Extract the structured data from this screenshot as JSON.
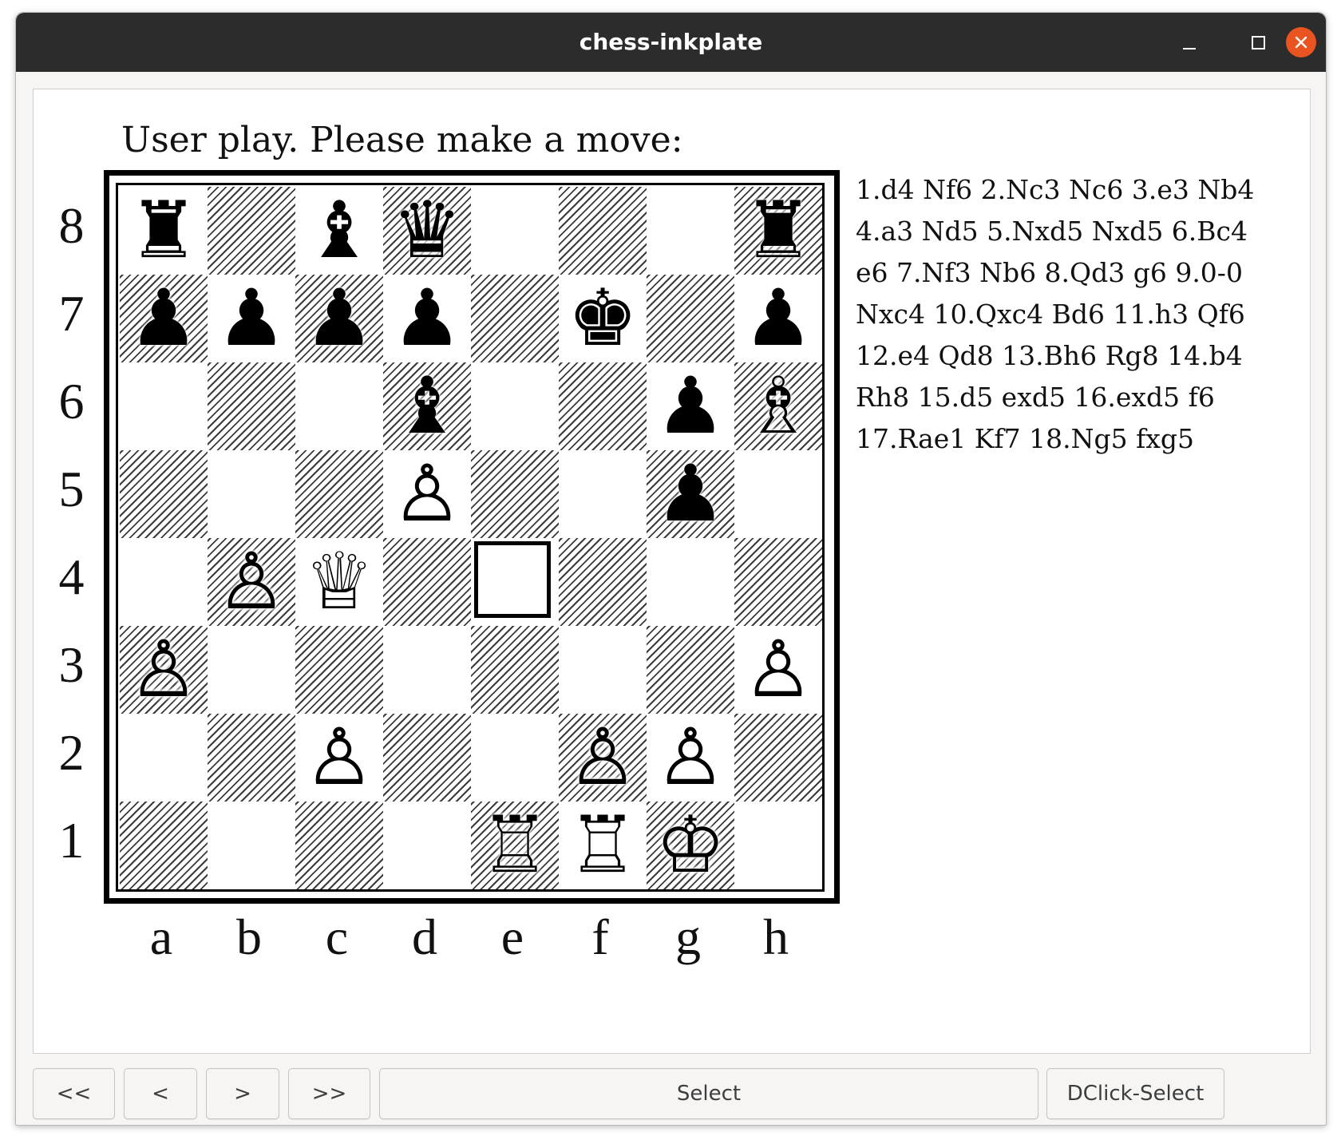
{
  "window": {
    "title": "chess-inkplate",
    "controls": [
      "minimize-icon",
      "maximize-icon",
      "close-icon"
    ],
    "close_color": "#e95420"
  },
  "prompt": "User play. Please make a move:",
  "moves_text": "1.d4 Nf6 2.Nc3 Nc6 3.e3 Nb4 4.a3 Nd5 5.Nxd5 Nxd5 6.Bc4 e6 7.Nf3 Nb6 8.Qd3 g6 9.0-0 Nxc4 10.Qxc4 Bd6 11.h3 Qf6 12.e4 Qd8 13.Bh6 Rg8 14.b4 Rh8 15.d5 exd5 16.exd5 f6 17.Rae1 Kf7 18.Ng5 fxg5",
  "board": {
    "ranks": [
      "8",
      "7",
      "6",
      "5",
      "4",
      "3",
      "2",
      "1"
    ],
    "files": [
      "a",
      "b",
      "c",
      "d",
      "e",
      "f",
      "g",
      "h"
    ],
    "selected_square": "e4",
    "position": [
      [
        "r",
        "",
        "b",
        "q",
        "",
        "",
        "",
        "r"
      ],
      [
        "p",
        "p",
        "p",
        "p",
        "",
        "k",
        "",
        "p"
      ],
      [
        "",
        "",
        "",
        "b",
        "",
        "",
        "p",
        "B"
      ],
      [
        "",
        "",
        "",
        "P",
        "",
        "",
        "p",
        ""
      ],
      [
        "",
        "P",
        "Q",
        "",
        "",
        "",
        "",
        ""
      ],
      [
        "P",
        "",
        "",
        "",
        "",
        "",
        "",
        "P"
      ],
      [
        "",
        "",
        "P",
        "",
        "",
        "P",
        "P",
        ""
      ],
      [
        "",
        "",
        "",
        "",
        "R",
        "R",
        "K",
        ""
      ]
    ]
  },
  "toolbar": {
    "first_label": "<<",
    "prev_label": "<",
    "next_label": ">",
    "last_label": ">>",
    "select_label": "Select",
    "dclick_label": "DClick-Select"
  }
}
